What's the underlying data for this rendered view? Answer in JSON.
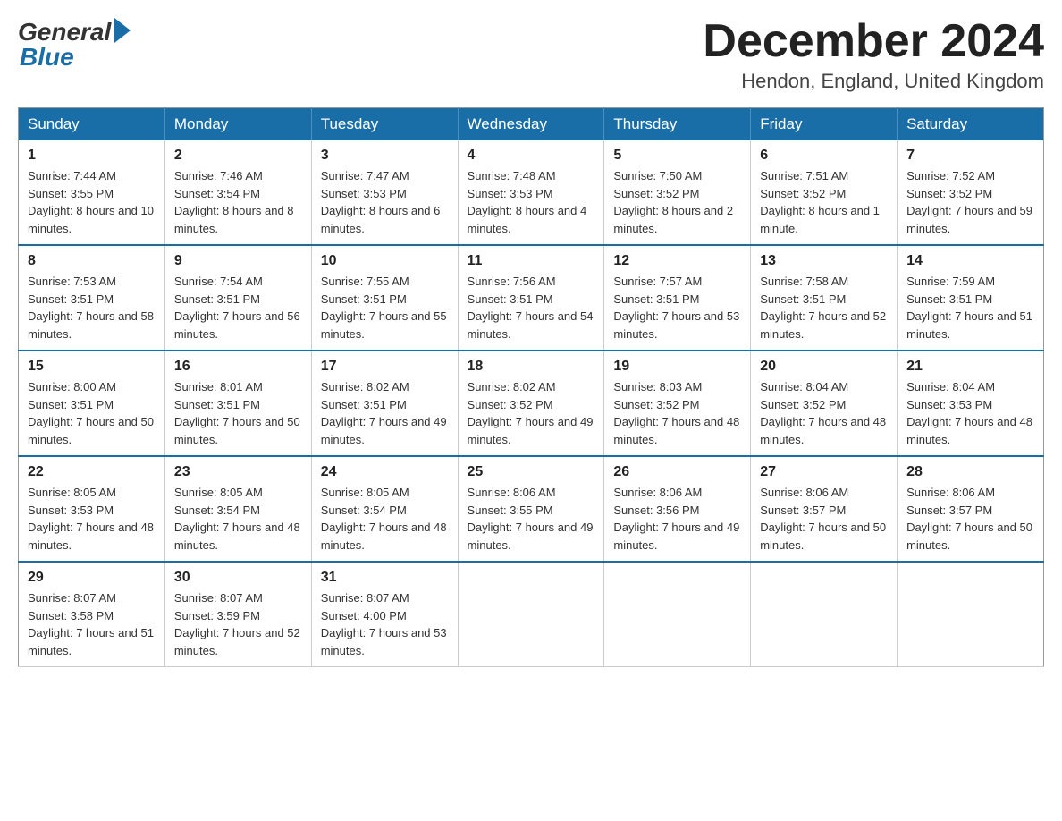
{
  "logo": {
    "general": "General",
    "blue": "Blue"
  },
  "title": {
    "month_year": "December 2024",
    "location": "Hendon, England, United Kingdom"
  },
  "weekdays": [
    "Sunday",
    "Monday",
    "Tuesday",
    "Wednesday",
    "Thursday",
    "Friday",
    "Saturday"
  ],
  "weeks": [
    [
      {
        "day": "1",
        "sunrise": "7:44 AM",
        "sunset": "3:55 PM",
        "daylight": "8 hours and 10 minutes."
      },
      {
        "day": "2",
        "sunrise": "7:46 AM",
        "sunset": "3:54 PM",
        "daylight": "8 hours and 8 minutes."
      },
      {
        "day": "3",
        "sunrise": "7:47 AM",
        "sunset": "3:53 PM",
        "daylight": "8 hours and 6 minutes."
      },
      {
        "day": "4",
        "sunrise": "7:48 AM",
        "sunset": "3:53 PM",
        "daylight": "8 hours and 4 minutes."
      },
      {
        "day": "5",
        "sunrise": "7:50 AM",
        "sunset": "3:52 PM",
        "daylight": "8 hours and 2 minutes."
      },
      {
        "day": "6",
        "sunrise": "7:51 AM",
        "sunset": "3:52 PM",
        "daylight": "8 hours and 1 minute."
      },
      {
        "day": "7",
        "sunrise": "7:52 AM",
        "sunset": "3:52 PM",
        "daylight": "7 hours and 59 minutes."
      }
    ],
    [
      {
        "day": "8",
        "sunrise": "7:53 AM",
        "sunset": "3:51 PM",
        "daylight": "7 hours and 58 minutes."
      },
      {
        "day": "9",
        "sunrise": "7:54 AM",
        "sunset": "3:51 PM",
        "daylight": "7 hours and 56 minutes."
      },
      {
        "day": "10",
        "sunrise": "7:55 AM",
        "sunset": "3:51 PM",
        "daylight": "7 hours and 55 minutes."
      },
      {
        "day": "11",
        "sunrise": "7:56 AM",
        "sunset": "3:51 PM",
        "daylight": "7 hours and 54 minutes."
      },
      {
        "day": "12",
        "sunrise": "7:57 AM",
        "sunset": "3:51 PM",
        "daylight": "7 hours and 53 minutes."
      },
      {
        "day": "13",
        "sunrise": "7:58 AM",
        "sunset": "3:51 PM",
        "daylight": "7 hours and 52 minutes."
      },
      {
        "day": "14",
        "sunrise": "7:59 AM",
        "sunset": "3:51 PM",
        "daylight": "7 hours and 51 minutes."
      }
    ],
    [
      {
        "day": "15",
        "sunrise": "8:00 AM",
        "sunset": "3:51 PM",
        "daylight": "7 hours and 50 minutes."
      },
      {
        "day": "16",
        "sunrise": "8:01 AM",
        "sunset": "3:51 PM",
        "daylight": "7 hours and 50 minutes."
      },
      {
        "day": "17",
        "sunrise": "8:02 AM",
        "sunset": "3:51 PM",
        "daylight": "7 hours and 49 minutes."
      },
      {
        "day": "18",
        "sunrise": "8:02 AM",
        "sunset": "3:52 PM",
        "daylight": "7 hours and 49 minutes."
      },
      {
        "day": "19",
        "sunrise": "8:03 AM",
        "sunset": "3:52 PM",
        "daylight": "7 hours and 48 minutes."
      },
      {
        "day": "20",
        "sunrise": "8:04 AM",
        "sunset": "3:52 PM",
        "daylight": "7 hours and 48 minutes."
      },
      {
        "day": "21",
        "sunrise": "8:04 AM",
        "sunset": "3:53 PM",
        "daylight": "7 hours and 48 minutes."
      }
    ],
    [
      {
        "day": "22",
        "sunrise": "8:05 AM",
        "sunset": "3:53 PM",
        "daylight": "7 hours and 48 minutes."
      },
      {
        "day": "23",
        "sunrise": "8:05 AM",
        "sunset": "3:54 PM",
        "daylight": "7 hours and 48 minutes."
      },
      {
        "day": "24",
        "sunrise": "8:05 AM",
        "sunset": "3:54 PM",
        "daylight": "7 hours and 48 minutes."
      },
      {
        "day": "25",
        "sunrise": "8:06 AM",
        "sunset": "3:55 PM",
        "daylight": "7 hours and 49 minutes."
      },
      {
        "day": "26",
        "sunrise": "8:06 AM",
        "sunset": "3:56 PM",
        "daylight": "7 hours and 49 minutes."
      },
      {
        "day": "27",
        "sunrise": "8:06 AM",
        "sunset": "3:57 PM",
        "daylight": "7 hours and 50 minutes."
      },
      {
        "day": "28",
        "sunrise": "8:06 AM",
        "sunset": "3:57 PM",
        "daylight": "7 hours and 50 minutes."
      }
    ],
    [
      {
        "day": "29",
        "sunrise": "8:07 AM",
        "sunset": "3:58 PM",
        "daylight": "7 hours and 51 minutes."
      },
      {
        "day": "30",
        "sunrise": "8:07 AM",
        "sunset": "3:59 PM",
        "daylight": "7 hours and 52 minutes."
      },
      {
        "day": "31",
        "sunrise": "8:07 AM",
        "sunset": "4:00 PM",
        "daylight": "7 hours and 53 minutes."
      },
      null,
      null,
      null,
      null
    ]
  ]
}
